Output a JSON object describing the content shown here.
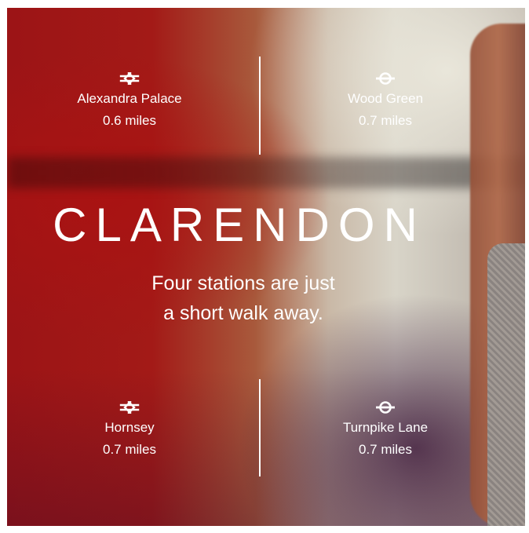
{
  "title": "CLARENDON",
  "tagline_line1": "Four stations are just",
  "tagline_line2": "a short walk away.",
  "stations": [
    {
      "name": "Alexandra Palace",
      "distance": "0.6 miles",
      "icon": "national-rail-icon"
    },
    {
      "name": "Wood Green",
      "distance": "0.7 miles",
      "icon": "underground-roundel-icon"
    },
    {
      "name": "Hornsey",
      "distance": "0.7 miles",
      "icon": "national-rail-icon"
    },
    {
      "name": "Turnpike Lane",
      "distance": "0.7 miles",
      "icon": "underground-roundel-icon"
    }
  ],
  "colors": {
    "text": "#ffffff",
    "accent_red": "#a31a17"
  }
}
